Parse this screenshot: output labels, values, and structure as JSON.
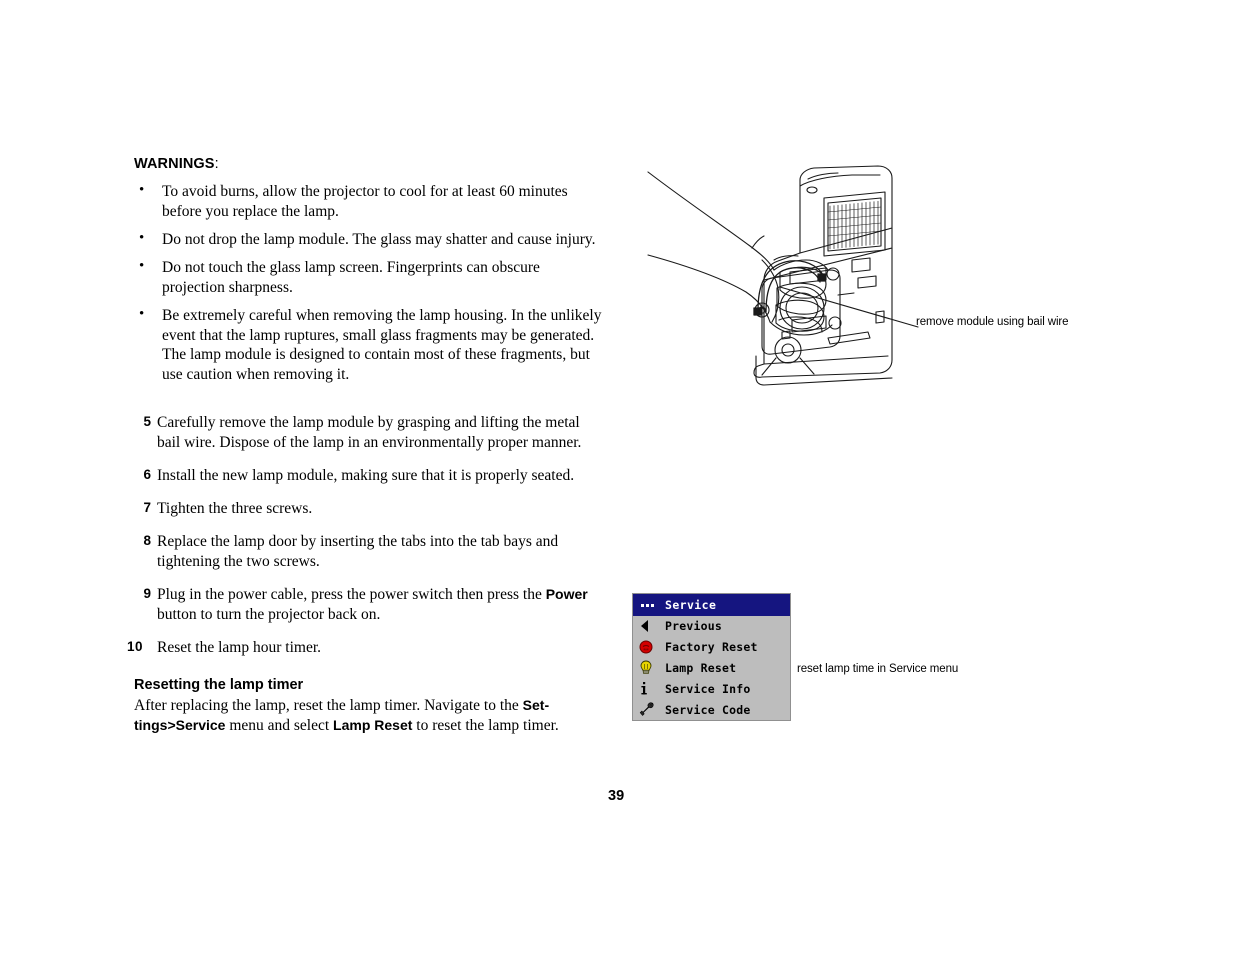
{
  "document": {
    "page_number": "39"
  },
  "warnings": {
    "heading_bold": "WARNINGS",
    "heading_suffix": ":",
    "items": [
      "To avoid burns, allow the projector to cool for at least 60 minutes before you replace the lamp.",
      "Do not drop the lamp module. The glass may shatter and cause injury.",
      "Do not touch the glass lamp screen. Fingerprints can obscure projection sharpness.",
      "Be extremely careful when removing the lamp housing. In the unlikely event that the lamp ruptures, small glass fragments may be generated. The lamp module is designed to contain most of these fragments, but use caution when removing it."
    ],
    "bullet_glyph": "•"
  },
  "steps": [
    {
      "number": "5",
      "text": "Carefully remove the lamp module by grasping and lifting the metal bail wire. Dispose of the lamp in an environmentally proper manner."
    },
    {
      "number": "6",
      "text": "Install the new lamp module, making sure that it is properly seated."
    },
    {
      "number": "7",
      "text": "Tighten the three screws."
    },
    {
      "number": "8",
      "text": "Replace the lamp door by inserting the tabs into the tab bays and tightening the two screws."
    },
    {
      "number": "9",
      "text_before": "Plug in the power cable, press the power switch then press the ",
      "bold": "Power",
      "text_after": " button to turn the projector back on."
    },
    {
      "number": "10",
      "text": "Reset the lamp hour timer."
    }
  ],
  "reset_section": {
    "title": "Resetting the lamp timer",
    "body_1": "After replacing the lamp, reset the lamp timer. Navigate to the ",
    "bold_1": "Set-tings>Service",
    "body_2": " menu and select ",
    "bold_2": "Lamp Reset",
    "body_3": " to reset the lamp timer."
  },
  "illustration": {
    "caption": "remove module using bail wire",
    "alt": "line drawing of projector with hand lifting lamp module by the bail wire"
  },
  "osd_menu": {
    "header": {
      "icon": "dots-icon",
      "title": "Service"
    },
    "header_bg": "#151580",
    "header_fg": "#ffffff",
    "body_bg": "#bdbdbd",
    "items": [
      {
        "icon": "triangle-left-icon",
        "label": "Previous"
      },
      {
        "icon": "factory-reset-icon",
        "label": "Factory Reset",
        "color": "#d40000"
      },
      {
        "icon": "lightbulb-icon",
        "label": "Lamp Reset",
        "color": "#e8d400"
      },
      {
        "icon": "info-icon",
        "label": "Service Info"
      },
      {
        "icon": "wrench-icon",
        "label": "Service Code"
      }
    ],
    "caption": "reset lamp time in Service menu"
  }
}
